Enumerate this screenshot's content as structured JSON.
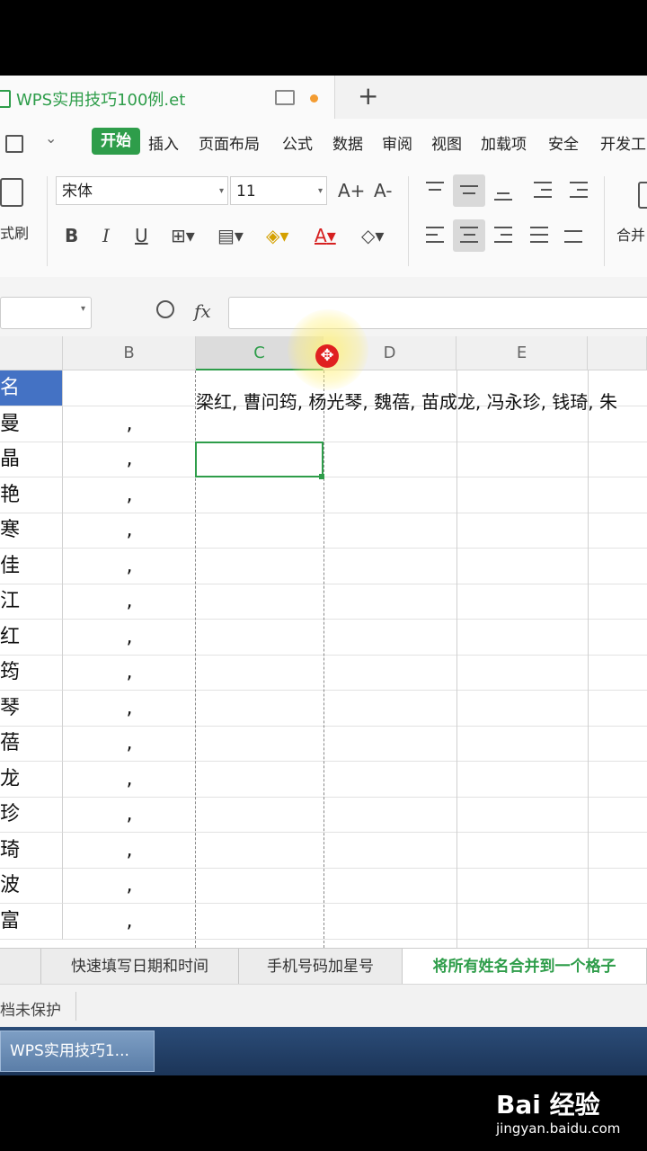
{
  "window": {
    "file_tab_title": "WPS实用技巧100例.et",
    "new_tab_symbol": "+"
  },
  "menu": {
    "items": [
      "开始",
      "插入",
      "页面布局",
      "公式",
      "数据",
      "审阅",
      "视图",
      "加载项",
      "安全",
      "开发工"
    ],
    "active": "开始"
  },
  "ribbon": {
    "format_painter_label": "式刷",
    "font_name": "宋体",
    "font_size": "11",
    "increase_font": "A+",
    "decrease_font": "A-",
    "bold": "B",
    "italic": "I",
    "underline": "U",
    "font_color_symbol": "A",
    "merge_label": "合并"
  },
  "formula_bar": {
    "fx_label": "fx",
    "name_box_value": "",
    "formula_value": ""
  },
  "columns": [
    "B",
    "C",
    "D",
    "E"
  ],
  "active_column": "C",
  "rows": {
    "col_a": [
      "名",
      "曼",
      "晶",
      "艳",
      "寒",
      "佳",
      "江",
      "红",
      "筠",
      "琴",
      "蓓",
      "龙",
      "珍",
      "琦",
      "波",
      "富"
    ],
    "col_b": [
      "",
      ",",
      ",",
      ",",
      ",",
      ",",
      ",",
      ",",
      ",",
      ",",
      ",",
      ",",
      ",",
      ",",
      ",",
      ","
    ]
  },
  "overflow_text": "梁红, 曹问筠, 杨光琴, 魏蓓, 苗成龙, 冯永珍, 钱琦, 朱",
  "sheet_tabs": [
    "快速填写日期和时间",
    "手机号码加星号",
    "将所有姓名合并到一个格子"
  ],
  "active_sheet": "将所有姓名合并到一个格子",
  "status": {
    "protection_text": "档未保护"
  },
  "taskbar": {
    "item_label": "WPS实用技巧1..."
  },
  "watermark": {
    "main": "Bai 经验",
    "sub": "jingyan.baidu.com"
  },
  "colors": {
    "accent_green": "#2e9d4a",
    "selected_blue": "#4472c4",
    "cursor_red": "#e02020"
  }
}
